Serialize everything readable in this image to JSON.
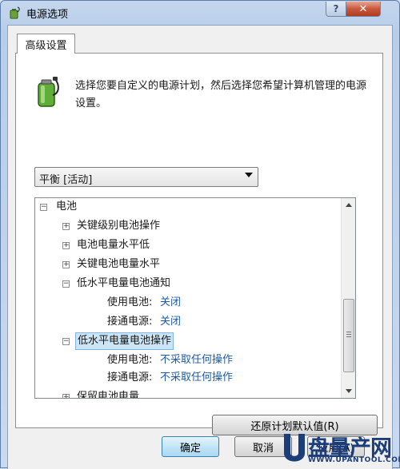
{
  "window": {
    "title": "电源选项",
    "help_label": "?",
    "close_label": "✕"
  },
  "tabs": [
    {
      "label": "高级设置",
      "active": true
    }
  ],
  "description": "选择您要自定义的电源计划，然后选择您希望计算机管理的电源设置。",
  "plan_select": {
    "value": "平衡 [活动]"
  },
  "tree": {
    "root": {
      "label": "电池",
      "expander": "−"
    },
    "items": [
      {
        "label": "关键级别电池操作",
        "expander": "+"
      },
      {
        "label": "电池电量水平低",
        "expander": "+"
      },
      {
        "label": "关键电池电量水平",
        "expander": "+"
      },
      {
        "label": "低水平电量电池通知",
        "expander": "−",
        "settings": [
          {
            "name": "使用电池:",
            "value": "关闭"
          },
          {
            "name": "接通电源:",
            "value": "关闭"
          }
        ]
      },
      {
        "label": "低水平电量电池操作",
        "expander": "−",
        "selected": true,
        "settings": [
          {
            "name": "使用电池:",
            "value": "不采取任何操作"
          },
          {
            "name": "接通电源:",
            "value": "不采取任何操作"
          }
        ]
      },
      {
        "label": "保留电池电量",
        "expander": "+"
      }
    ]
  },
  "buttons": {
    "restore": "还原计划默认值(R)",
    "ok": "确定",
    "cancel": "取消",
    "apply": "应用(A)"
  },
  "watermark": {
    "cn": "盘量产网",
    "en": "WWW.UPANTOOL.COM"
  },
  "colors": {
    "link_value": "#1e5aa8",
    "selection_bg": "#cde6f7",
    "close_button": "#c75a3f"
  }
}
